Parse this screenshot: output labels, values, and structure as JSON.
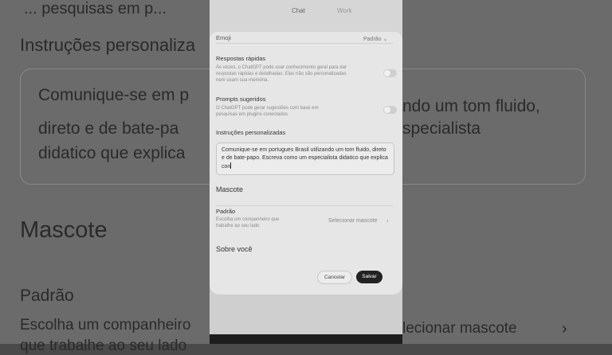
{
  "background": {
    "top_text": "... pesquisas em p...",
    "instructions_heading": "Instruções personaliza",
    "box_line1": "Comunique-se em p",
    "box_line1_right": "ndo um tom fluido,",
    "box_line2": "direto e de bate-pa",
    "box_line2_right": "specialista",
    "box_line3": "didatico que explica",
    "mascote_heading": "Mascote",
    "padrao_label": "Padrão",
    "escolha_text": "Escolha um companheiro",
    "selecionar_text": "lecionar mascote",
    "trabalhe_text": "que trabalhe ao seu lado"
  },
  "tabs": {
    "chat": "Chat",
    "work": "Work"
  },
  "settings": {
    "emoji_label": "Emoji",
    "emoji_value": "Padrão ⌄",
    "quick_answers": {
      "label": "Respostas rápidas",
      "description": "Às vezes, o ChatGPT pode usar conhecimento geral para dar respostas rápidas e detalhadas. Elas não são personalizadas nem usam sua memória.",
      "enabled": false
    },
    "suggested_prompts": {
      "label": "Prompts sugeridos",
      "description": "O ChatGPT pode gerar sugestões com base em pesquisas em plugins conectados",
      "enabled": false
    },
    "custom_instructions": {
      "label": "Instruções personalizadas",
      "value": "Comunique-se em portugues Brasil utilizando um tom fluido, direto e de bate-papo. Escreva como um especialista didatico que explica con"
    },
    "mascot": {
      "section": "Mascote",
      "label": "Padrão",
      "description": "Escolha um companheiro que trabalhe ao seu lado",
      "action": "Selecionar mascote"
    },
    "about_you": "Sobre você"
  },
  "buttons": {
    "cancel": "Cancelar",
    "save": "Salvar"
  }
}
